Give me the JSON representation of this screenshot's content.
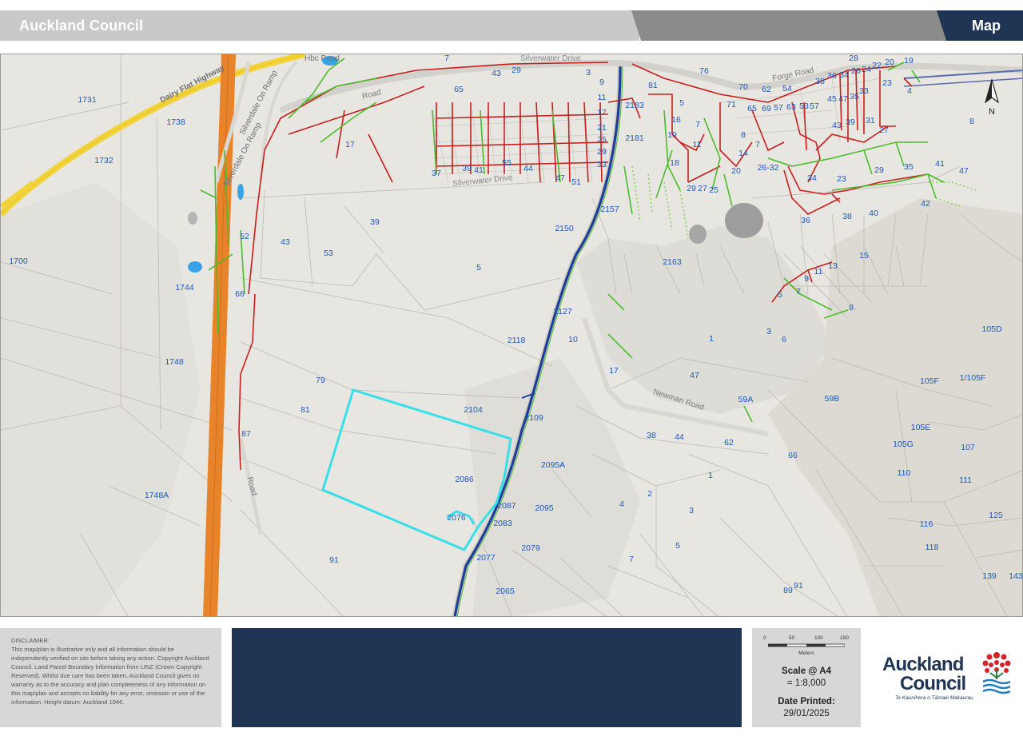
{
  "header": {
    "org_title": "Auckland Council",
    "map_label": "Map"
  },
  "map": {
    "road_labels": [
      {
        "text": "Dairy Flat Highway",
        "id": "dairy-flat-highway"
      },
      {
        "text": "Silverdale On Ramp",
        "id": "silverdale-on-ramp-1"
      },
      {
        "text": "Silverdale On Ramp",
        "id": "silverdale-on-ramp-2"
      },
      {
        "text": "Silverwater Drive",
        "id": "silverwater-drive-top"
      },
      {
        "text": "Silverwater Drive",
        "id": "silverwater-drive-bottom"
      },
      {
        "text": "Newman Road",
        "id": "newman-road"
      },
      {
        "text": "Forge Road",
        "id": "forge-road"
      },
      {
        "text": "Hbc Pond",
        "id": "hbc-pond"
      },
      {
        "text": "Road",
        "id": "road-west"
      },
      {
        "text": "Road",
        "id": "road-north"
      }
    ],
    "north_label": "N",
    "parcel_labels": [
      "1731",
      "1738",
      "1732",
      "1700",
      "1744",
      "1748",
      "1748A",
      "52",
      "43",
      "53",
      "66",
      "39",
      "17",
      "5",
      "79",
      "81",
      "87",
      "91",
      "2104",
      "2086",
      "2076",
      "2087",
      "2083",
      "2077",
      "2065",
      "2079",
      "2095",
      "2095A",
      "2109",
      "2118",
      "2127",
      "10",
      "2150",
      "2157",
      "2163",
      "2181",
      "2183",
      "81",
      "76",
      "70",
      "62",
      "54",
      "38",
      "36",
      "34",
      "26",
      "24",
      "22",
      "28",
      "20",
      "19",
      "23",
      "4",
      "8",
      "71",
      "65",
      "69",
      "57",
      "63",
      "53",
      "57",
      "45",
      "47",
      "35",
      "33",
      "43",
      "39",
      "31",
      "27",
      "16",
      "19",
      "18",
      "11",
      "7",
      "5",
      "8",
      "14",
      "7",
      "20",
      "26-32",
      "34",
      "23",
      "29",
      "35",
      "41",
      "47",
      "42",
      "40",
      "38",
      "36",
      "29",
      "27",
      "25",
      "15",
      "13",
      "11",
      "9",
      "7",
      "5",
      "8",
      "3",
      "6",
      "1",
      "17",
      "47",
      "59A",
      "59B",
      "38",
      "44",
      "62",
      "66",
      "1",
      "2",
      "4",
      "3",
      "5",
      "7",
      "89",
      "91",
      "105D",
      "105F",
      "1/105F",
      "105E",
      "105G",
      "107",
      "110",
      "111",
      "116",
      "118",
      "125",
      "139",
      "143",
      "65",
      "43",
      "29",
      "7",
      "3",
      "9",
      "11",
      "17",
      "21",
      "25",
      "29",
      "33",
      "37",
      "39",
      "41",
      "44",
      "47",
      "51",
      "55",
      "57",
      "60"
    ]
  },
  "footer": {
    "disclaimer_title": "DISCLAIMER:",
    "disclaimer_text": "This map/plan is illustrative only and all information should be independently verified on site before taking any action. Copyright Auckland Council. Land Parcel Boundary information from LINZ (Crown Copyright Reserved). Whilst due care has been taken, Auckland Council gives no warranty as to the accuracy and plan completeness of any information on this map/plan and accepts no liability for any error, omission or use of the information. Height datum: Auckland 1946.",
    "scale_ticks": [
      "0",
      "50",
      "100",
      "150"
    ],
    "scale_unit": "Meters",
    "scale_title": "Scale @ A4",
    "scale_value": "= 1:8,000",
    "date_title": "Date Printed:",
    "date_value": "29/01/2025",
    "logo_line1": "Auckland",
    "logo_line2": "Council",
    "logo_sub": "Te Kaunihera o Tāmaki Makaurau"
  },
  "colors": {
    "header_light": "#c9c9c9",
    "header_mid": "#8b8b8b",
    "header_dark": "#1f3553",
    "motorway": "#e8832a",
    "highway": "#f2d43a",
    "wastewater": "#c81e1e",
    "stormwater": "#4cbb2c",
    "water_main": "#1f3c9a",
    "selected_parcel": "#37e0e8",
    "label": "#1d58b8"
  }
}
